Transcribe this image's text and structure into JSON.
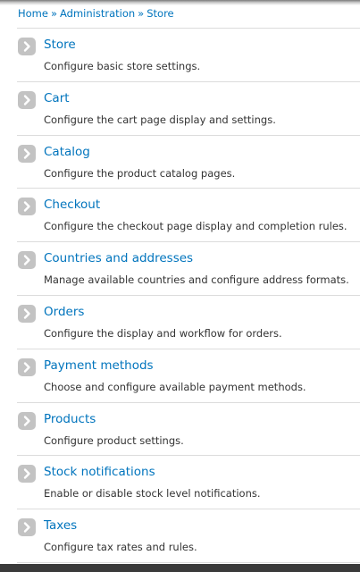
{
  "breadcrumb": {
    "items": [
      "Home",
      "Administration",
      "Store"
    ],
    "separator": "»"
  },
  "items": [
    {
      "title": "Store",
      "description": "Configure basic store settings.",
      "icon": "chevron-right-icon"
    },
    {
      "title": "Cart",
      "description": "Configure the cart page display and settings.",
      "icon": "chevron-right-icon"
    },
    {
      "title": "Catalog",
      "description": "Configure the product catalog pages.",
      "icon": "chevron-right-icon"
    },
    {
      "title": "Checkout",
      "description": "Configure the checkout page display and completion rules.",
      "icon": "chevron-right-icon"
    },
    {
      "title": "Countries and addresses",
      "description": "Manage available countries and configure address formats.",
      "icon": "chevron-right-icon"
    },
    {
      "title": "Orders",
      "description": "Configure the display and workflow for orders.",
      "icon": "chevron-right-icon"
    },
    {
      "title": "Payment methods",
      "description": "Choose and configure available payment methods.",
      "icon": "chevron-right-icon"
    },
    {
      "title": "Products",
      "description": "Configure product settings.",
      "icon": "chevron-right-icon"
    },
    {
      "title": "Stock notifications",
      "description": "Enable or disable stock level notifications.",
      "icon": "chevron-right-icon"
    },
    {
      "title": "Taxes",
      "description": "Configure tax rates and rules.",
      "icon": "chevron-right-icon"
    }
  ],
  "colors": {
    "link": "#0074bd",
    "text": "#333333",
    "divider": "#dcdcdc",
    "icon_bg": "#c3c3c3"
  }
}
